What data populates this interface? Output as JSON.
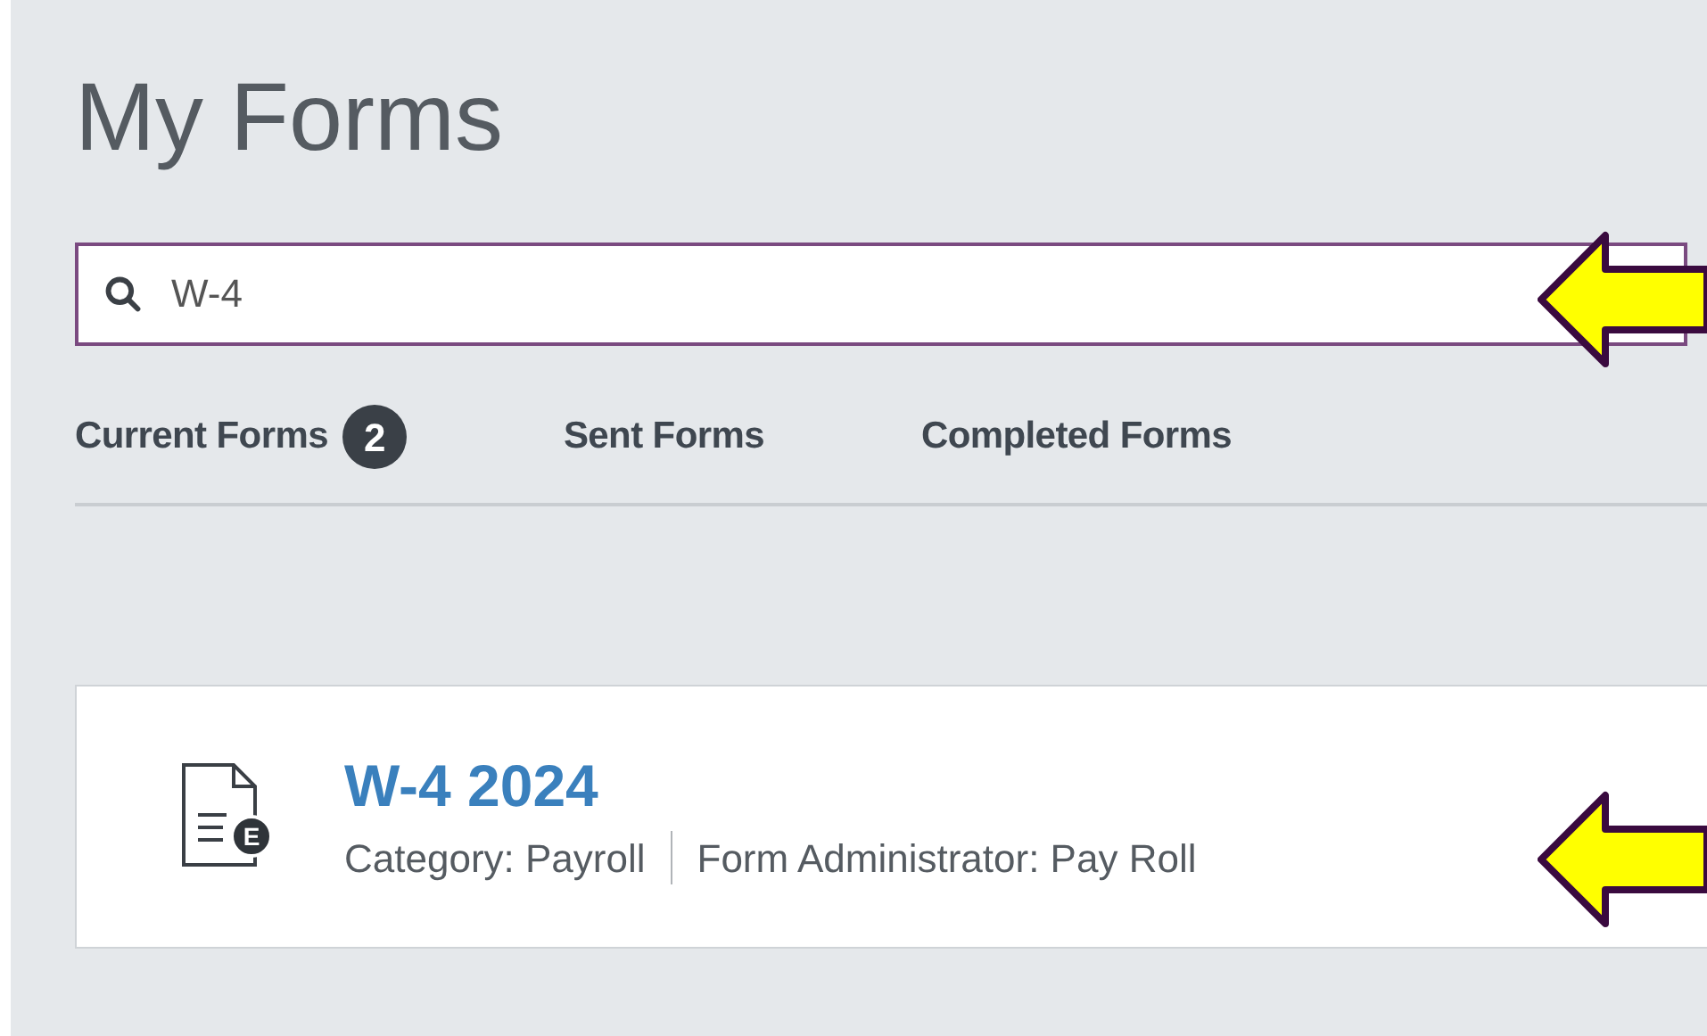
{
  "title": "My Forms",
  "search": {
    "value": "W-4"
  },
  "tabs": [
    {
      "label": "Current Forms",
      "count": "2"
    },
    {
      "label": "Sent Forms"
    },
    {
      "label": "Completed Forms"
    }
  ],
  "forms": [
    {
      "title": "W-4 2024",
      "icon_badge": "E",
      "category": "Category: Payroll",
      "administrator": "Form Administrator: Pay Roll"
    }
  ],
  "annotations": [
    {
      "kind": "arrow"
    },
    {
      "kind": "arrow"
    }
  ]
}
